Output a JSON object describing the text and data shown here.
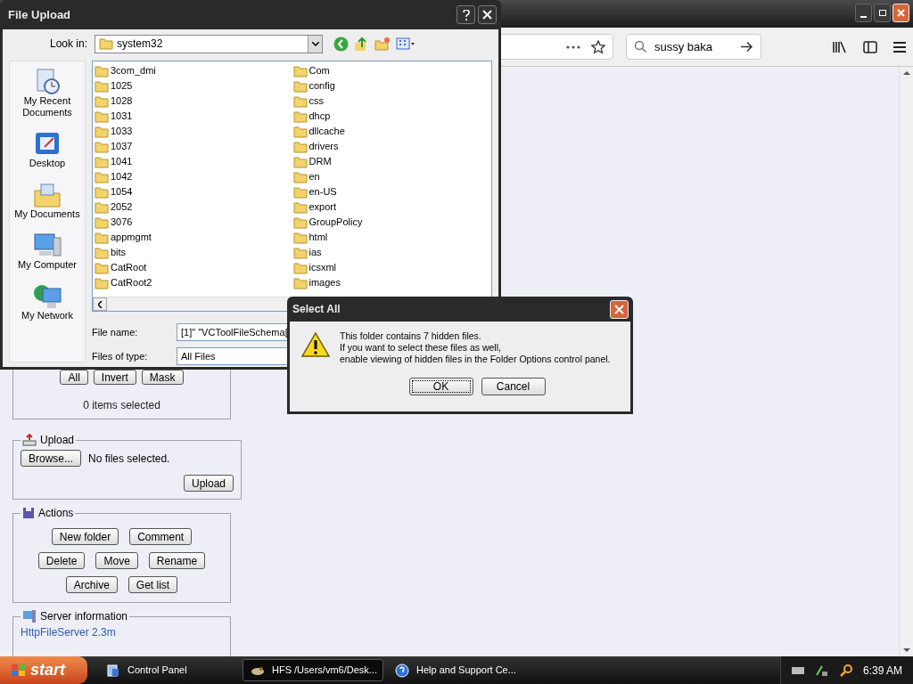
{
  "browser": {
    "search": {
      "value": "sussy baka"
    },
    "page": {
      "selection": {
        "buttons": [
          "All",
          "Invert",
          "Mask"
        ],
        "status": "0 items selected"
      },
      "upload": {
        "title": "Upload",
        "browse": "Browse...",
        "status": "No files selected.",
        "button": "Upload"
      },
      "actions": {
        "title": "Actions",
        "rows": [
          [
            "New folder",
            "Comment"
          ],
          [
            "Delete",
            "Move",
            "Rename"
          ],
          [
            "Archive",
            "Get list"
          ]
        ]
      },
      "server_info": {
        "title": "Server information",
        "link": "HttpFileServer 2.3m"
      }
    }
  },
  "file_dialog": {
    "title": "File Upload",
    "look_in_label": "Look in:",
    "look_in": "system32",
    "places": [
      {
        "kind": "recent",
        "label": "My Recent Documents"
      },
      {
        "kind": "desktop",
        "label": "Desktop"
      },
      {
        "kind": "documents",
        "label": "My Documents"
      },
      {
        "kind": "computer",
        "label": "My Computer"
      },
      {
        "kind": "network",
        "label": "My Network"
      }
    ],
    "files": [
      "3com_dmi",
      "1025",
      "1028",
      "1031",
      "1033",
      "1037",
      "1041",
      "1042",
      "1054",
      "2052",
      "3076",
      "appmgmt",
      "bits",
      "CatRoot",
      "CatRoot2",
      "Com",
      "config",
      "css",
      "dhcp",
      "dllcache",
      "drivers",
      "DRM",
      "en",
      "en-US",
      "export",
      "GroupPolicy",
      "html",
      "ias",
      "icsxml",
      "images"
    ],
    "file_name_label": "File name:",
    "file_name": "[1]\" \"VCToolFileSchema[",
    "file_type_label": "Files of type:",
    "file_type": "All Files"
  },
  "alert": {
    "title": "Select All",
    "lines": [
      "This folder contains 7 hidden files.",
      "If you want to select these files as well,",
      "enable viewing of hidden files in the Folder Options control panel."
    ],
    "buttons": [
      {
        "label": "OK",
        "selected": true
      },
      {
        "label": "Cancel",
        "selected": false
      }
    ]
  },
  "taskbar": {
    "start": "start",
    "tasks": [
      {
        "kind": "panel",
        "label": "Control Panel",
        "selected": false
      },
      {
        "kind": "hfs",
        "label": "HFS /Users/vm6/Desk...",
        "selected": true
      },
      {
        "kind": "help",
        "label": "Help and Support Ce...",
        "selected": false
      }
    ],
    "clock": "6:39 AM"
  }
}
